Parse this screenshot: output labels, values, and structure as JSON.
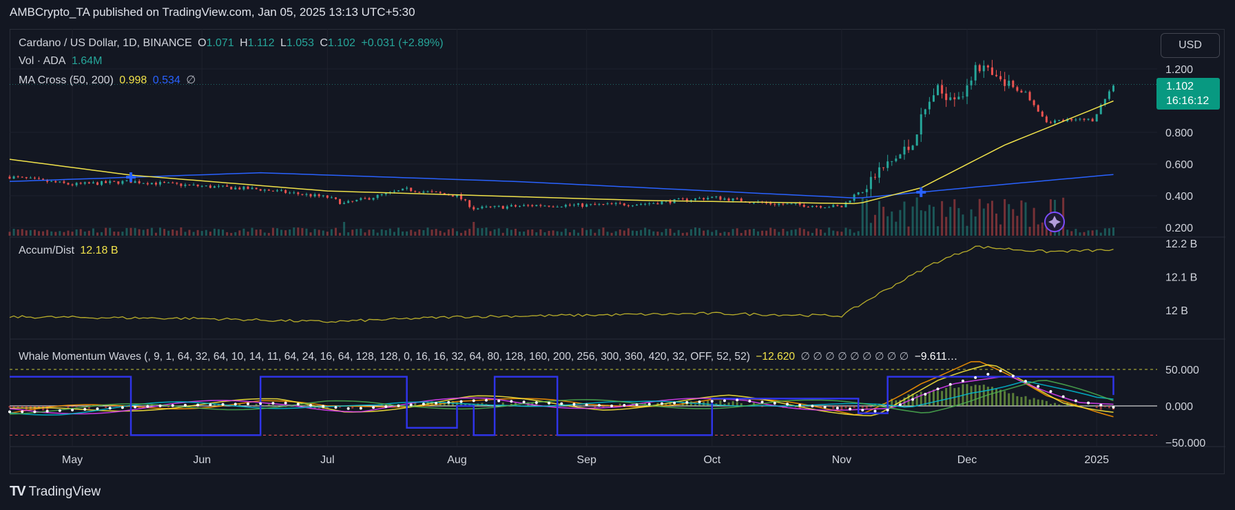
{
  "header": {
    "publisher": "AMBCrypto_TA published on TradingView.com, Jan 05, 2025 13:13 UTC+5:30"
  },
  "legend": {
    "symbol": "Cardano / US Dollar, 1D, BINANCE",
    "o_label": "O",
    "o_val": "1.071",
    "h_label": "H",
    "h_val": "1.112",
    "l_label": "L",
    "l_val": "1.053",
    "c_label": "C",
    "c_val": "1.102",
    "change": "+0.031 (+2.89%)",
    "vol_label": "Vol · ADA",
    "vol_val": "1.64M",
    "ma_label": "MA Cross (50, 200)",
    "ma_fast": "0.998",
    "ma_slow": "0.534",
    "ma_extra": "∅",
    "ad_label": "Accum/Dist",
    "ad_val": "12.18 B",
    "whale_label": "Whale Momentum Waves (, 9, 1, 64, 32, 64, 10, 14, 11, 64, 24, 16, 64, 128, 128, 0, 16, 16, 32, 64, 80, 128, 160, 200, 256, 300, 360, 420, 32, OFF, 52, 52)",
    "whale_val1": "−12.620",
    "whale_nulls": "∅ ∅ ∅ ∅ ∅ ∅ ∅ ∅ ∅",
    "whale_val2": "−9.611…"
  },
  "currency_button": "USD",
  "price_tag": {
    "price": "1.102",
    "countdown": "16:16:12"
  },
  "footer": {
    "brand": "TradingView",
    "logo": "TV"
  },
  "colors": {
    "up": "#26a69a",
    "down": "#ef5350",
    "ma_fast": "#f0e24a",
    "ma_slow": "#2962ff",
    "ad_line": "#b8ad2a"
  },
  "chart_data": [
    {
      "type": "candlestick",
      "title": "Cardano / US Dollar, 1D, BINANCE",
      "x_tick_labels": [
        "May",
        "Jun",
        "Jul",
        "Aug",
        "Sep",
        "Oct",
        "Nov",
        "Dec",
        "2025"
      ],
      "y_tick_labels": [
        "1.200",
        "0.800",
        "0.600",
        "0.400",
        "0.200"
      ],
      "y_ticks": [
        1.2,
        0.8,
        0.6,
        0.4,
        0.2
      ],
      "ylim": [
        0.2,
        1.25
      ],
      "price_anchors": [
        {
          "date": "Apr 16",
          "close": 0.52
        },
        {
          "date": "May 01",
          "close": 0.47
        },
        {
          "date": "May 15",
          "close": 0.49
        },
        {
          "date": "Jun 01",
          "close": 0.46
        },
        {
          "date": "Jun 15",
          "close": 0.44
        },
        {
          "date": "Jul 01",
          "close": 0.39
        },
        {
          "date": "Jul 05",
          "close": 0.35
        },
        {
          "date": "Jul 20",
          "close": 0.44
        },
        {
          "date": "Aug 01",
          "close": 0.4
        },
        {
          "date": "Aug 05",
          "close": 0.32
        },
        {
          "date": "Aug 20",
          "close": 0.34
        },
        {
          "date": "Sep 01",
          "close": 0.34
        },
        {
          "date": "Sep 15",
          "close": 0.35
        },
        {
          "date": "Oct 01",
          "close": 0.39
        },
        {
          "date": "Oct 15",
          "close": 0.35
        },
        {
          "date": "Nov 01",
          "close": 0.33
        },
        {
          "date": "Nov 10",
          "close": 0.55
        },
        {
          "date": "Nov 17",
          "close": 0.7
        },
        {
          "date": "Nov 23",
          "close": 1.05
        },
        {
          "date": "Dec 01",
          "close": 1.05
        },
        {
          "date": "Dec 03",
          "close": 1.25
        },
        {
          "date": "Dec 08",
          "close": 1.12
        },
        {
          "date": "Dec 15",
          "close": 1.05
        },
        {
          "date": "Dec 20",
          "close": 0.87
        },
        {
          "date": "Dec 31",
          "close": 0.88
        },
        {
          "date": "Jan 05",
          "close": 1.102
        }
      ],
      "ma_fast_anchors": [
        {
          "date": "Apr 16",
          "value": 0.63
        },
        {
          "date": "May 15",
          "value": 0.53
        },
        {
          "date": "Jul 01",
          "value": 0.43
        },
        {
          "date": "Sep 15",
          "value": 0.37
        },
        {
          "date": "Nov 05",
          "value": 0.35
        },
        {
          "date": "Nov 20",
          "value": 0.45
        },
        {
          "date": "Dec 10",
          "value": 0.72
        },
        {
          "date": "Dec 25",
          "value": 0.88
        },
        {
          "date": "Jan 05",
          "value": 0.998
        }
      ],
      "ma_slow_anchors": [
        {
          "date": "Apr 16",
          "value": 0.49
        },
        {
          "date": "Jun 15",
          "value": 0.545
        },
        {
          "date": "Aug 15",
          "value": 0.49
        },
        {
          "date": "Nov 05",
          "value": 0.385
        },
        {
          "date": "Dec 01",
          "value": 0.45
        },
        {
          "date": "Jan 05",
          "value": 0.534
        }
      ],
      "cross_markers": [
        "May 15",
        "Nov 20"
      ],
      "last_price": 1.102
    },
    {
      "type": "line",
      "title": "Accum/Dist",
      "y_tick_labels": [
        "12.2 B",
        "12.1 B",
        "12 B"
      ],
      "y_ticks": [
        12.2,
        12.1,
        12.0
      ],
      "ylim": [
        11.96,
        12.2
      ],
      "anchors": [
        {
          "date": "Apr 16",
          "value": 11.98
        },
        {
          "date": "Jun 01",
          "value": 11.975
        },
        {
          "date": "Jul 01",
          "value": 11.965
        },
        {
          "date": "Aug 01",
          "value": 11.98
        },
        {
          "date": "Sep 01",
          "value": 11.985
        },
        {
          "date": "Oct 01",
          "value": 11.99
        },
        {
          "date": "Nov 01",
          "value": 11.983
        },
        {
          "date": "Nov 10",
          "value": 12.05
        },
        {
          "date": "Nov 23",
          "value": 12.14
        },
        {
          "date": "Dec 03",
          "value": 12.19
        },
        {
          "date": "Dec 20",
          "value": 12.175
        },
        {
          "date": "Jan 05",
          "value": 12.18
        }
      ]
    },
    {
      "type": "line",
      "title": "Whale Momentum Waves",
      "y_tick_labels": [
        "50.000",
        "0.000",
        "−50.000"
      ],
      "y_ticks": [
        50,
        0,
        -50
      ],
      "ylim": [
        -55,
        75
      ],
      "anchors": [
        {
          "date": "Apr 16",
          "value": -10
        },
        {
          "date": "May 15",
          "value": 0
        },
        {
          "date": "Jun 15",
          "value": 5
        },
        {
          "date": "Jul 01",
          "value": -5
        },
        {
          "date": "Aug 01",
          "value": 10
        },
        {
          "date": "Sep 01",
          "value": 0
        },
        {
          "date": "Oct 01",
          "value": 10
        },
        {
          "date": "Nov 05",
          "value": -10
        },
        {
          "date": "Nov 20",
          "value": 35
        },
        {
          "date": "Dec 03",
          "value": 60
        },
        {
          "date": "Dec 20",
          "value": 10
        },
        {
          "date": "Jan 05",
          "value": -9.611
        }
      ]
    }
  ]
}
